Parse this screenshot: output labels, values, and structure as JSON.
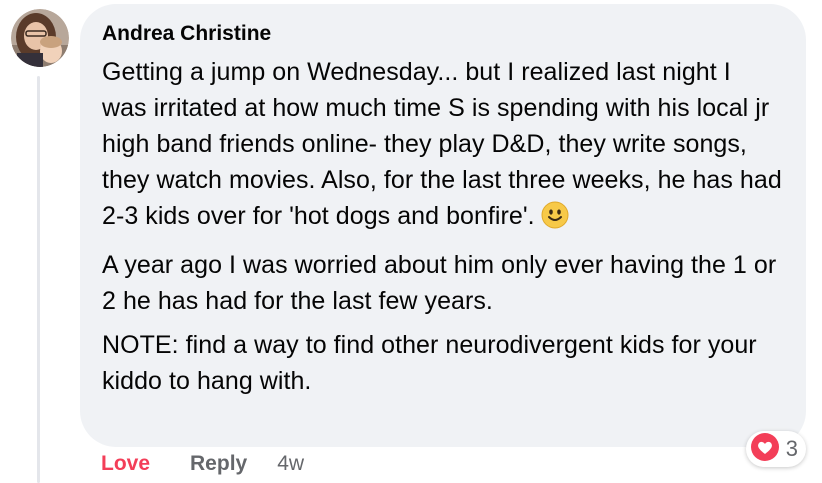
{
  "comment": {
    "author": "Andrea Christine",
    "paragraphs": [
      "Getting a jump on Wednesday... but I realized last night I was irritated at how much time S is spending with his local jr high band friends online- they play D&D, they write songs, they watch movies. Also, for the last three weeks, he has had 2-3 kids over for 'hot dogs and bonfire'.",
      "A year ago I was worried about him only ever having the 1 or 2 he has had for the last few years.",
      "NOTE: find a way to find other neurodivergent kids for your kiddo to hang with."
    ],
    "emoji_icon": "smiling-face-icon"
  },
  "reactions": {
    "icon": "heart-reaction-icon",
    "count": "3",
    "color": "#f33e58"
  },
  "actions": {
    "love_label": "Love",
    "reply_label": "Reply",
    "time_label": "4w"
  },
  "colors": {
    "bubble": "#f0f2f5",
    "text": "#050505",
    "muted": "#65676b",
    "love": "#f33e58"
  }
}
